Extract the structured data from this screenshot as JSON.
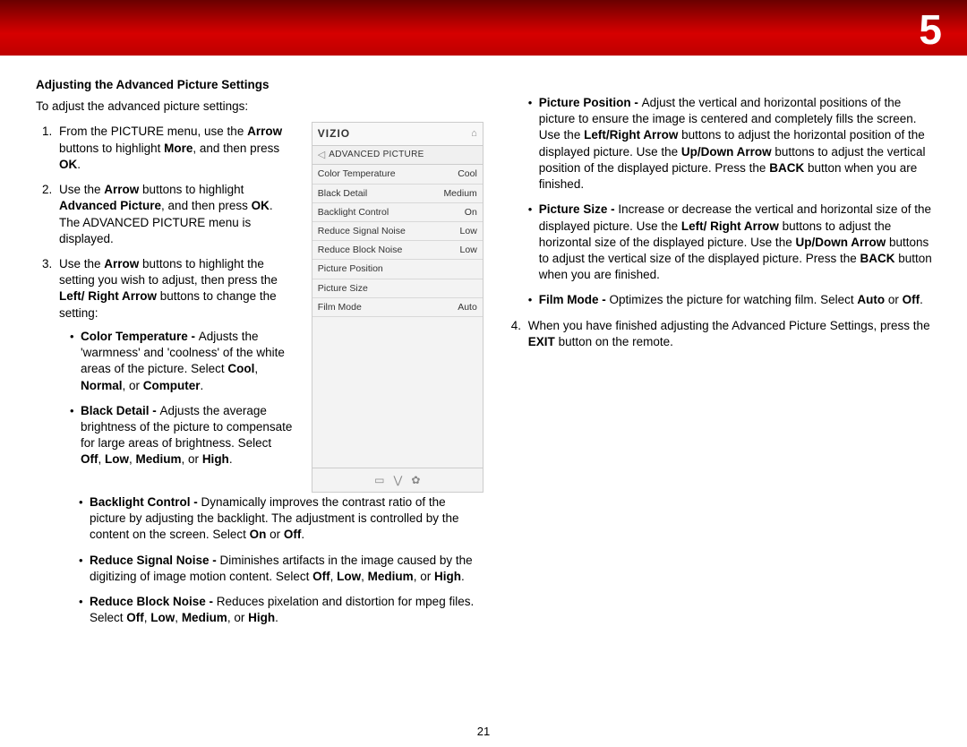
{
  "chapter": "5",
  "pageNumber": "21",
  "left": {
    "sectionTitle": "Adjusting the Advanced Picture Settings",
    "intro": "To adjust the advanced picture settings:",
    "step1_a": "From the PICTURE menu, use the ",
    "step1_b": " buttons to highlight ",
    "step1_c": ", and then press ",
    "step1_arrow": "Arrow",
    "step1_more": "More",
    "step1_ok": "OK",
    "step1_end": ".",
    "step2_a": "Use the ",
    "step2_arrow": "Arrow",
    "step2_b": " buttons to highlight ",
    "step2_adv": "Advanced Picture",
    "step2_c": ", and then press ",
    "step2_ok": "OK",
    "step2_d": ". The ADVANCED PICTURE menu is displayed.",
    "step3_a": "Use the ",
    "step3_arrow": "Arrow",
    "step3_b": " buttons to highlight the setting you wish to adjust, then press the ",
    "step3_lr": "Left/ Right Arrow",
    "step3_c": " buttons to change the setting:",
    "ct_a": "Color Temperature - ",
    "ct_b": "Adjusts the 'warmness' and 'coolness' of the white areas of the picture. Select ",
    "ct_cool": "Cool",
    "ct_c": ", ",
    "ct_normal": "Normal",
    "ct_d": ", or ",
    "ct_comp": "Computer",
    "ct_e": ".",
    "bd_a": "Black Detail - ",
    "bd_b": "Adjusts the average brightness of the picture to compensate for large areas of brightness. Select ",
    "bd_off": "Off",
    "bd_c": ", ",
    "bd_low": "Low",
    "bd_d": ", ",
    "bd_med": "Medium",
    "bd_e": ", or ",
    "bd_high": "High",
    "bd_f": ".",
    "bc_a": "Backlight Control - ",
    "bc_b": "Dynamically improves the contrast ratio of the picture by adjusting the backlight. The adjustment is controlled by the content on the screen. Select ",
    "bc_on": "On",
    "bc_c": " or ",
    "bc_off": "Off",
    "bc_d": ".",
    "rsn_a": "Reduce Signal Noise - ",
    "rsn_b": "Diminishes artifacts in the image caused by the digitizing of image motion content. Select ",
    "rsn_off": "Off",
    "rsn_c": ", ",
    "rsn_low": "Low",
    "rsn_d": ", ",
    "rsn_med": "Medium",
    "rsn_e": ", or ",
    "rsn_high": "High",
    "rsn_f": ".",
    "rbn_a": "Reduce Block Noise - ",
    "rbn_b": "Reduces pixelation and distortion for mpeg files. Select ",
    "rbn_off": "Off",
    "rbn_c": ", ",
    "rbn_low": "Low",
    "rbn_d": ", ",
    "rbn_med": "Medium",
    "rbn_e": ", or ",
    "rbn_high": "High",
    "rbn_f": "."
  },
  "panel": {
    "logo": "VIZIO",
    "homeIcon": "⌂",
    "backIcon": "◁",
    "title": "ADVANCED PICTURE",
    "rows": [
      {
        "label": "Color Temperature",
        "value": "Cool"
      },
      {
        "label": "Black Detail",
        "value": "Medium"
      },
      {
        "label": "Backlight Control",
        "value": "On"
      },
      {
        "label": "Reduce Signal Noise",
        "value": "Low"
      },
      {
        "label": "Reduce Block Noise",
        "value": "Low"
      },
      {
        "label": "Picture Position",
        "value": ""
      },
      {
        "label": "Picture Size",
        "value": ""
      },
      {
        "label": "Film Mode",
        "value": "Auto"
      }
    ],
    "footer": {
      "a": "▭",
      "b": "⋁",
      "c": "✿"
    }
  },
  "right": {
    "pp_a": "Picture Position - ",
    "pp_b": "Adjust the vertical and horizontal positions of the picture to ensure the image is centered and completely fills the screen. Use the ",
    "pp_lr": "Left/Right Arrow",
    "pp_c": " buttons to adjust the horizontal position of the displayed picture. Use the ",
    "pp_ud": "Up/Down Arrow",
    "pp_d": " buttons to adjust the vertical position of the displayed picture. Press the ",
    "pp_back": "BACK",
    "pp_e": " button when you are finished.",
    "ps_a": "Picture Size - ",
    "ps_b": "Increase or decrease the vertical and horizontal size of the displayed picture. Use the ",
    "ps_lr": "Left/ Right Arrow",
    "ps_c": " buttons to adjust the horizontal size of the displayed picture. Use the ",
    "ps_ud": "Up/Down Arrow",
    "ps_d": " buttons to adjust the vertical size of the displayed picture. Press the ",
    "ps_back": "BACK",
    "ps_e": " button when you are finished.",
    "fm_a": "Film Mode - ",
    "fm_b": "Optimizes the picture for watching film. Select ",
    "fm_auto": "Auto",
    "fm_c": " or ",
    "fm_off": "Off",
    "fm_d": ".",
    "step4_a": "When you have finished adjusting the Advanced Picture Settings, press the ",
    "step4_exit": "EXIT",
    "step4_b": " button on the remote."
  }
}
